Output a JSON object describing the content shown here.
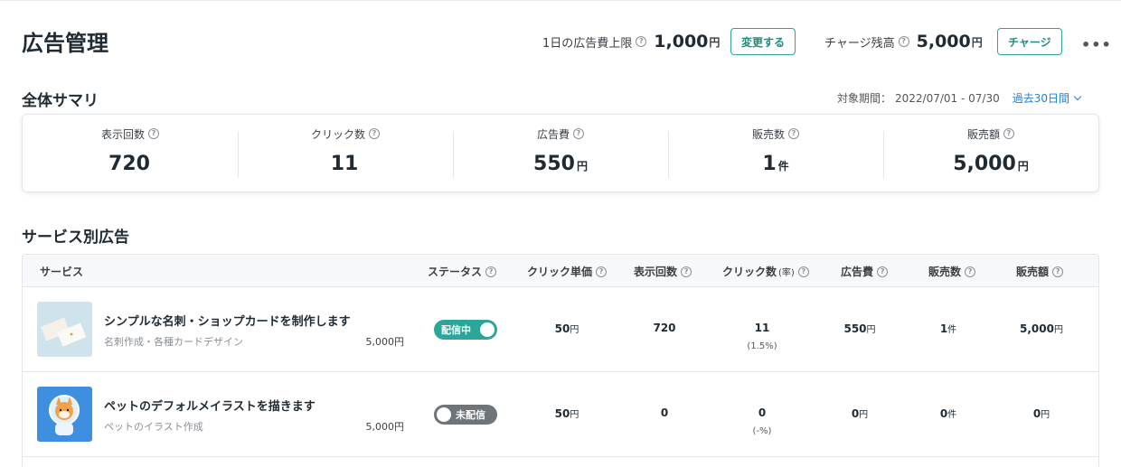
{
  "header": {
    "title": "広告管理",
    "daily_limit_label": "1日の広告費上限",
    "daily_limit_value": "1,000",
    "daily_limit_unit": "円",
    "change_button": "変更する",
    "charge_balance_label": "チャージ残高",
    "charge_balance_value": "5,000",
    "charge_balance_unit": "円",
    "charge_button": "チャージ",
    "more_label": "•••"
  },
  "summary": {
    "title": "全体サマリ",
    "period_label": "対象期間：",
    "period_value": "2022/07/01 - 07/30",
    "period_selector": "過去30日間",
    "cards": [
      {
        "label": "表示回数",
        "value": "720",
        "unit": ""
      },
      {
        "label": "クリック数",
        "value": "11",
        "unit": ""
      },
      {
        "label": "広告費",
        "value": "550",
        "unit": "円"
      },
      {
        "label": "販売数",
        "value": "1",
        "unit": "件"
      },
      {
        "label": "販売額",
        "value": "5,000",
        "unit": "円"
      }
    ]
  },
  "services": {
    "title": "サービス別広告",
    "columns": {
      "service": "サービス",
      "status": "ステータス",
      "cpc": "クリック単価",
      "impressions": "表示回数",
      "clicks": "クリック数",
      "clicks_rate": "(率)",
      "ad_cost": "広告費",
      "sales_count": "販売数",
      "sales_amount": "販売額"
    },
    "rows": [
      {
        "title": "シンプルな名刺・ショップカードを制作します",
        "category": "名刺作成・各種カードデザイン",
        "price": "5,000円",
        "status": "配信中",
        "cpc": "50",
        "cpc_unit": "円",
        "impressions": "720",
        "clicks": "11",
        "click_rate": "(1.5%)",
        "ad_cost": "550",
        "ad_cost_unit": "円",
        "sales_count": "1",
        "sales_count_unit": "件",
        "sales_amount": "5,000",
        "sales_amount_unit": "円"
      },
      {
        "title": "ペットのデフォルメイラストを描きます",
        "category": "ペットのイラスト作成",
        "price": "5,000円",
        "status": "未配信",
        "cpc": "50",
        "cpc_unit": "円",
        "impressions": "0",
        "clicks": "0",
        "click_rate": "(-%)",
        "ad_cost": "0",
        "ad_cost_unit": "円",
        "sales_count": "0",
        "sales_count_unit": "件",
        "sales_amount": "0",
        "sales_amount_unit": "円"
      }
    ]
  },
  "colors": {
    "accent": "#2aa69a",
    "link": "#1f7fd6",
    "status_off": "#6f7479"
  },
  "icons": [
    "help-icon",
    "chevron-down-icon",
    "more-icon"
  ]
}
